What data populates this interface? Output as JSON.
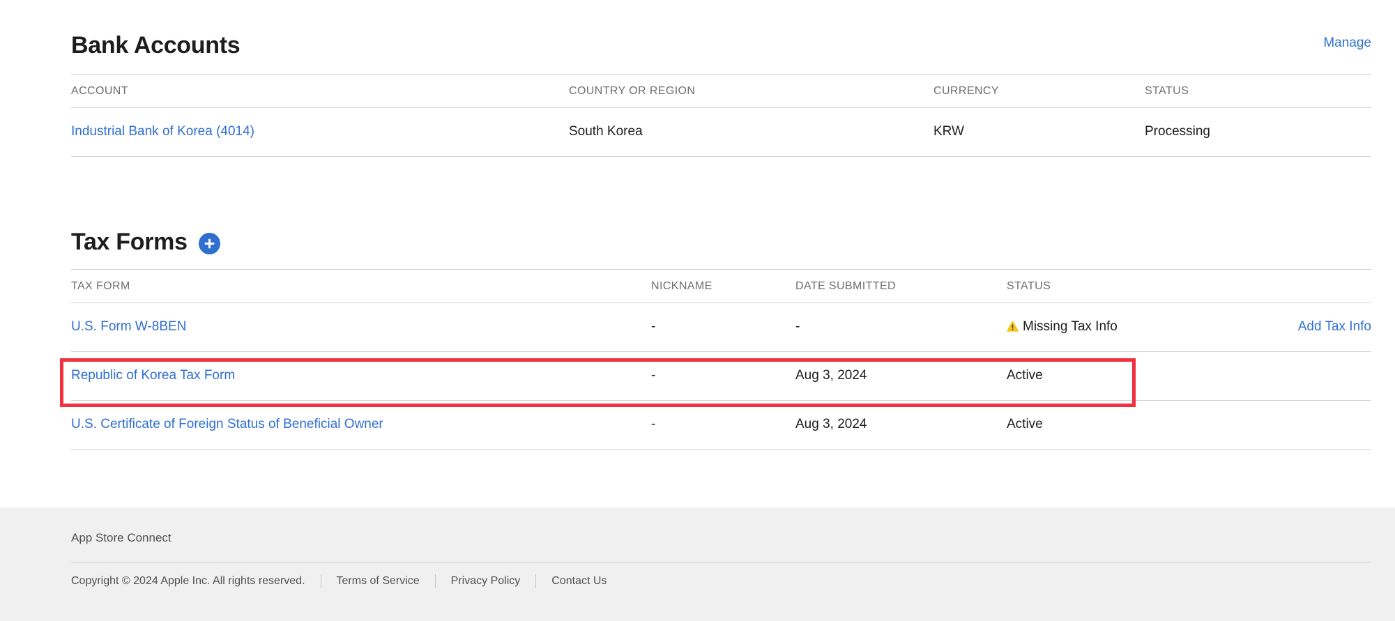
{
  "bank_accounts": {
    "title": "Bank Accounts",
    "manage_label": "Manage",
    "columns": [
      "ACCOUNT",
      "COUNTRY OR REGION",
      "CURRENCY",
      "STATUS"
    ],
    "rows": [
      {
        "account": "Industrial Bank of Korea (4014)",
        "country": "South Korea",
        "currency": "KRW",
        "status": "Processing"
      }
    ]
  },
  "tax_forms": {
    "title": "Tax Forms",
    "add_icon": "plus-circle-icon",
    "columns": [
      "TAX FORM",
      "NICKNAME",
      "DATE SUBMITTED",
      "STATUS"
    ],
    "rows": [
      {
        "form": "U.S. Form W-8BEN",
        "nickname": "-",
        "date": "-",
        "status": "Missing Tax Info",
        "status_icon": "warning-icon",
        "action": "Add Tax Info"
      },
      {
        "form": "Republic of Korea Tax Form",
        "nickname": "-",
        "date": "Aug 3, 2024",
        "status": "Active"
      },
      {
        "form": "U.S. Certificate of Foreign Status of Beneficial Owner",
        "nickname": "-",
        "date": "Aug 3, 2024",
        "status": "Active"
      }
    ]
  },
  "footer": {
    "title": "App Store Connect",
    "copyright": "Copyright © 2024 Apple Inc. All rights reserved.",
    "links": [
      "Terms of Service",
      "Privacy Policy",
      "Contact Us"
    ]
  },
  "colors": {
    "link": "#2f6fd0",
    "highlight": "#f0313f",
    "warning": "#f5c518",
    "footer_bg": "#f0f0f0"
  }
}
